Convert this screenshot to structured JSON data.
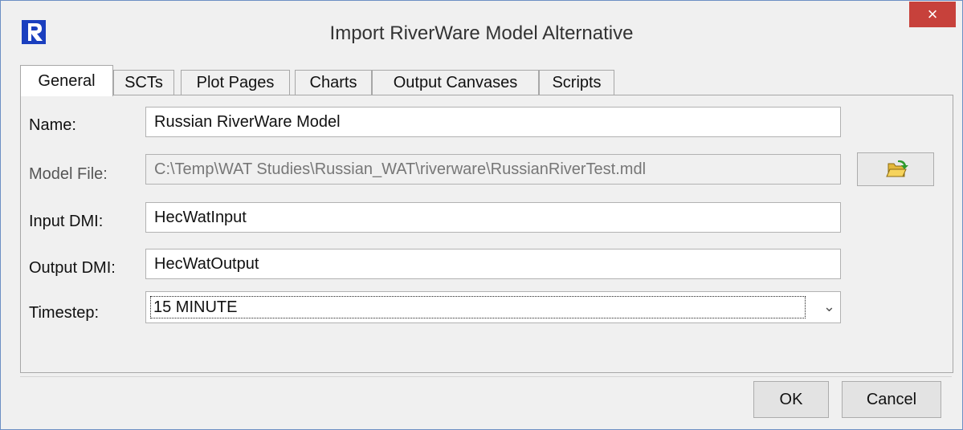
{
  "window": {
    "title": "Import RiverWare Model Alternative",
    "close_label": "×"
  },
  "tabs": [
    {
      "label": "General",
      "active": true
    },
    {
      "label": "SCTs"
    },
    {
      "label": "Plot Pages"
    },
    {
      "label": "Charts"
    },
    {
      "label": "Output Canvases"
    },
    {
      "label": "Scripts"
    }
  ],
  "form": {
    "name": {
      "label": "Name:",
      "value": "Russian RiverWare Model"
    },
    "model_file": {
      "label": "Model File:",
      "value": "C:\\Temp\\WAT Studies\\Russian_WAT\\riverware\\RussianRiverTest.mdl"
    },
    "input_dmi": {
      "label": "Input DMI:",
      "value": "HecWatInput"
    },
    "output_dmi": {
      "label": "Output DMI:",
      "value": "HecWatOutput"
    },
    "timestep": {
      "label": "Timestep:",
      "value": "15 MINUTE"
    }
  },
  "buttons": {
    "ok": "OK",
    "cancel": "Cancel"
  },
  "icons": {
    "app": "riverware-logo-icon",
    "browse": "open-folder-icon",
    "dropdown": "chevron-down-icon"
  }
}
